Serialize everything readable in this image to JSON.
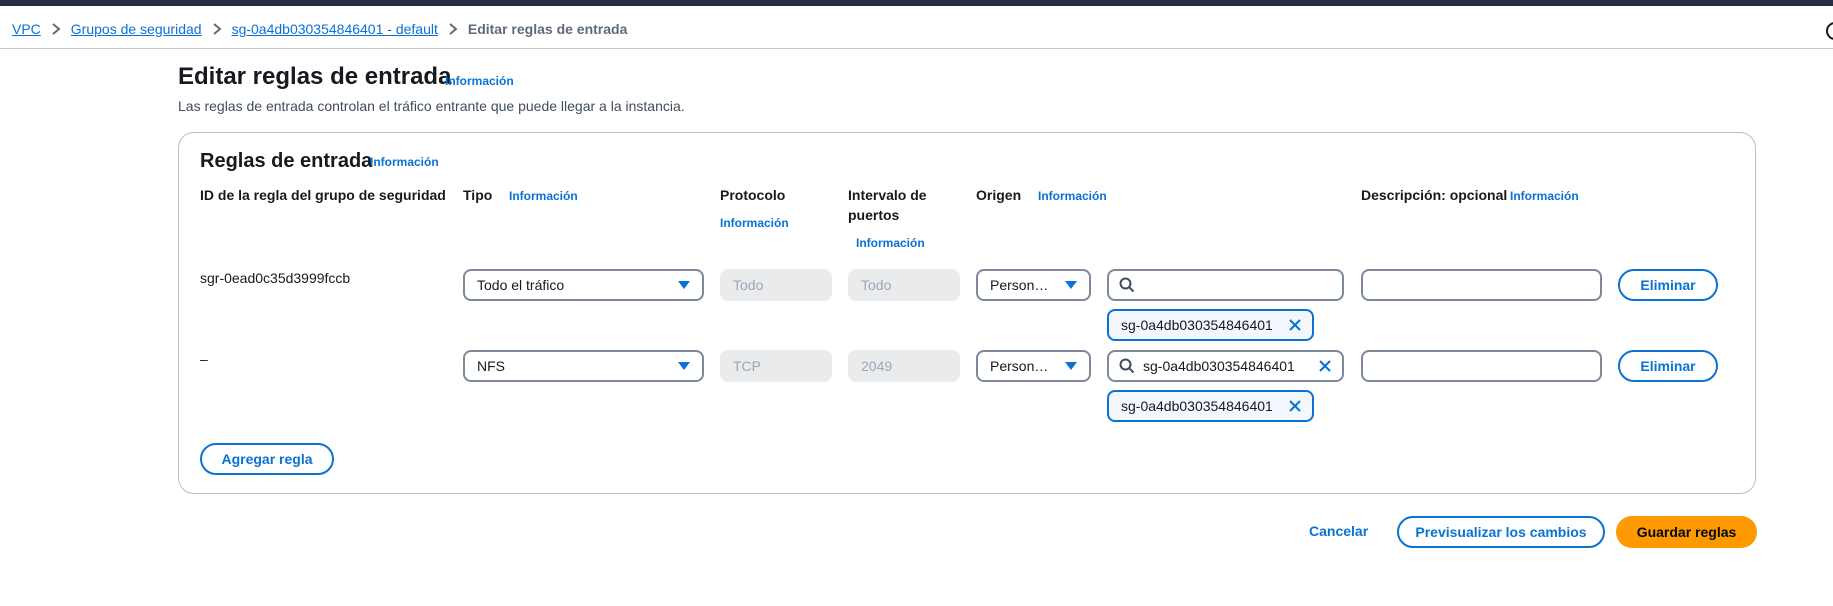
{
  "breadcrumb": {
    "items": [
      "VPC",
      "Grupos de seguridad",
      "sg-0a4db030354846401 - default"
    ],
    "current": "Editar reglas de entrada"
  },
  "page": {
    "title": "Editar reglas de entrada",
    "info": "Información",
    "description": "Las reglas de entrada controlan el tráfico entrante que puede llegar a la instancia."
  },
  "panel": {
    "title": "Reglas de entrada",
    "info": "Información",
    "columns": {
      "rule_id": "ID de la regla del grupo de seguridad",
      "type": "Tipo",
      "type_info": "Información",
      "protocol": "Protocolo",
      "protocol_info": "Información",
      "port_range": "Intervalo de puertos",
      "port_range_info": "Información",
      "source": "Origen",
      "source_info": "Información",
      "description": "Descripción: opcional",
      "description_info": "Información"
    },
    "rules": [
      {
        "rule_id": "sgr-0ead0c35d3999fccb",
        "type": "Todo el tráfico",
        "protocol": "Todo",
        "port_range": "Todo",
        "source": "Person…",
        "search_value": "",
        "token": "sg-0a4db030354846401",
        "description": "",
        "delete_label": "Eliminar"
      },
      {
        "rule_id": "–",
        "type": "NFS",
        "protocol": "TCP",
        "port_range": "2049",
        "source": "Person…",
        "search_value": "sg-0a4db030354846401",
        "token": "sg-0a4db030354846401",
        "description": "",
        "delete_label": "Eliminar"
      }
    ],
    "add_rule_label": "Agregar regla"
  },
  "footer": {
    "cancel_label": "Cancelar",
    "preview_label": "Previsualizar los cambios",
    "save_label": "Guardar reglas"
  },
  "icons": {
    "chevron": "chevron-right-icon",
    "caret": "caret-down-icon",
    "search": "search-icon",
    "close": "close-icon"
  },
  "colors": {
    "link": "#0972d3",
    "primary_button": "#ff9900",
    "border": "#7d8998",
    "disabled_bg": "#e9ebed"
  }
}
